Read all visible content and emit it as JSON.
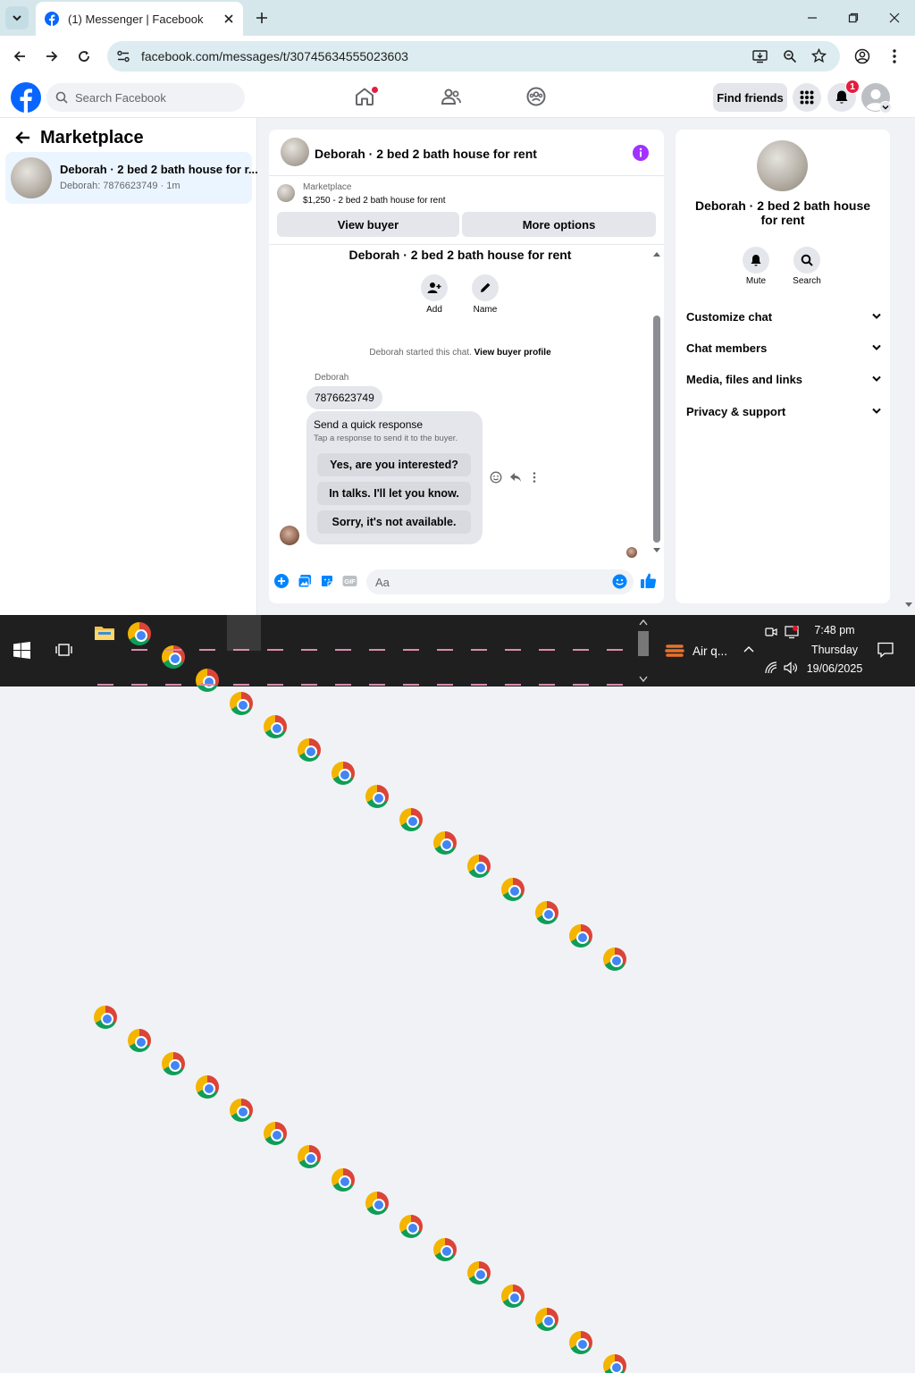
{
  "browser": {
    "tab_title": "(1) Messenger | Facebook",
    "url": "facebook.com/messages/t/30745634555023603"
  },
  "fb_header": {
    "search_placeholder": "Search Facebook",
    "find_friends": "Find friends",
    "notification_count": "1"
  },
  "left": {
    "title": "Marketplace",
    "conversation": {
      "title": "Deborah · 2 bed 2 bath house for r...",
      "subtitle": "Deborah: 7876623749 · 1m"
    }
  },
  "chat": {
    "header_title": "Deborah · 2 bed 2 bath house for rent",
    "listing_source": "Marketplace",
    "listing_detail": "$1,250 - 2 bed 2 bath house for rent",
    "view_buyer": "View buyer",
    "more_options": "More options",
    "thread_title": "Deborah · 2 bed 2 bath house for rent",
    "add_label": "Add",
    "name_label": "Name",
    "started_text": "Deborah started this chat.",
    "view_buyer_profile": "View buyer profile",
    "sender_name": "Deborah",
    "message": "7876623749",
    "quick_title": "Send a quick response",
    "quick_subtitle": "Tap a response to send it to the buyer.",
    "quick_responses": [
      "Yes, are you interested?",
      "In talks. I'll let you know.",
      "Sorry, it's not available."
    ],
    "composer_placeholder": "Aa"
  },
  "right": {
    "title": "Deborah · 2 bed 2 bath house for rent",
    "mute": "Mute",
    "search": "Search",
    "sections": [
      "Customize chat",
      "Chat members",
      "Media, files and links",
      "Privacy & support"
    ]
  },
  "taskbar": {
    "weather": "Air q...",
    "time": "7:48 pm",
    "day": "Thursday",
    "date": "19/06/2025"
  },
  "colors": {
    "fb_blue": "#0866ff",
    "messenger_blue": "#0084ff",
    "info_purple": "#a033ff",
    "notif_red": "#e41e3f"
  }
}
